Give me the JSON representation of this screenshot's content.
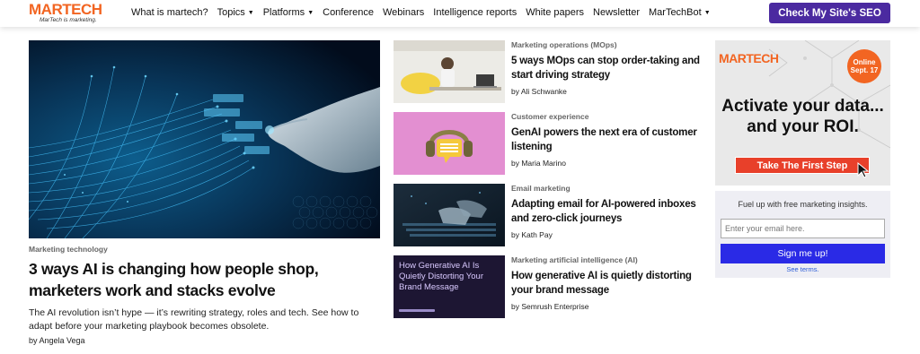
{
  "header": {
    "logo_text": "MARTECH",
    "logo_tagline": "MarTech is marketing.",
    "nav": [
      {
        "label": "What is martech?",
        "dropdown": false
      },
      {
        "label": "Topics",
        "dropdown": true
      },
      {
        "label": "Platforms",
        "dropdown": true
      },
      {
        "label": "Conference",
        "dropdown": false
      },
      {
        "label": "Webinars",
        "dropdown": false
      },
      {
        "label": "Intelligence reports",
        "dropdown": false
      },
      {
        "label": "White papers",
        "dropdown": false
      },
      {
        "label": "Newsletter",
        "dropdown": false
      },
      {
        "label": "MarTechBot",
        "dropdown": true
      }
    ],
    "cta_label": "Check My Site's SEO"
  },
  "hero": {
    "category": "Marketing technology",
    "title": "3 ways AI is changing how people shop, marketers work and stacks evolve",
    "description": "The AI revolution isn’t hype — it’s rewriting strategy, roles and tech. See how to adapt before your marketing playbook becomes obsolete.",
    "byline": "by Angela Vega"
  },
  "articles": [
    {
      "category": "Marketing operations (MOps)",
      "title": "5 ways MOps can stop order-taking and start driving strategy",
      "byline": "by Ali Schwanke"
    },
    {
      "category": "Customer experience",
      "title": "GenAI powers the next era of customer listening",
      "byline": "by Maria Marino"
    },
    {
      "category": "Email marketing",
      "title": "Adapting email for AI-powered inboxes and zero-click journeys",
      "byline": "by Kath Pay"
    },
    {
      "category": "Marketing artificial intelligence (AI)",
      "title": "How generative AI is quietly distorting your brand message",
      "byline": "by Semrush Enterprise"
    }
  ],
  "thumb4_text": "How Generative AI Is Quietly Distorting Your Brand Message",
  "ad": {
    "logo": "MARTECH",
    "badge_line1": "Online",
    "badge_line2": "Sept. 17",
    "headline_line1": "Activate your data...",
    "headline_line2": "and your ROI.",
    "button_label": "Take The First Step"
  },
  "newsletter": {
    "title": "Fuel up with free marketing insights.",
    "placeholder": "Enter your email here.",
    "button_label": "Sign me up!",
    "terms": "See terms."
  },
  "colors": {
    "brand_orange": "#f26522",
    "cta_purple": "#4b2aa0",
    "signup_blue": "#2a2ae6",
    "ad_red": "#e8402a"
  }
}
